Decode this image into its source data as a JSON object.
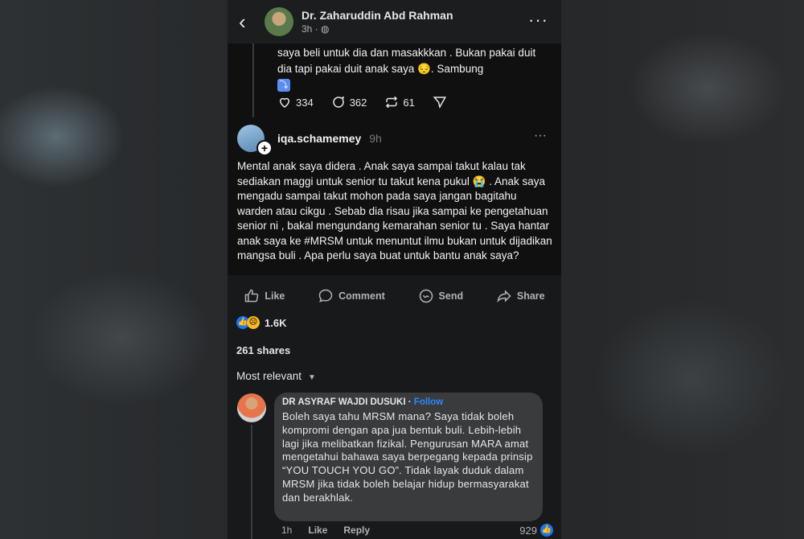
{
  "header": {
    "author": "Dr. Zaharuddin Abd Rahman",
    "meta": "3h · ◍"
  },
  "thread_post": {
    "text": "saya beli untuk dia dan masakkkan . Bukan pakai duit dia tapi pakai duit anak saya 😔. Sambung",
    "continue_icon": "⤵",
    "likes": "334",
    "comments": "362",
    "reposts": "61"
  },
  "reply_post": {
    "username": "iqa.schamemey",
    "time": "9h",
    "body": "Mental anak saya didera . Anak saya sampai takut kalau tak sediakan maggi untuk senior tu takut kena pukul 😭 . Anak saya mengadu sampai takut mohon pada saya jangan bagitahu warden atau cikgu . Sebab dia risau jika sampai ke pengetahuan senior ni , bakal mengundang kemarahan senior tu . Saya hantar anak saya ke #MRSM untuk menuntut ilmu bukan untuk dijadikan mangsa buli . Apa perlu saya buat untuk bantu anak saya?"
  },
  "fb_actions": {
    "like": "Like",
    "comment": "Comment",
    "send": "Send",
    "share": "Share"
  },
  "stats": {
    "reactions": "1.6K",
    "shares": "261 shares"
  },
  "sort": {
    "label": "Most relevant"
  },
  "comment": {
    "author": "DR ASYRAF WAJDI DUSUKI",
    "follow": "Follow",
    "text": "Boleh saya tahu MRSM mana? Saya tidak boleh kompromi dengan apa jua bentuk buli. Lebih-lebih lagi jika melibatkan fizikal. Pengurusan MARA amat mengetahui bahawa saya berpegang kepada prinsip “YOU TOUCH YOU GO”. Tidak layak duduk dalam MRSM jika tidak boleh belajar hidup bermasyarakat dan berakhlak.",
    "time": "1h",
    "like": "Like",
    "reply": "Reply",
    "count": "929"
  },
  "colors": {
    "background": "#18191a",
    "card": "#101010",
    "bubble": "#3a3b3c",
    "link": "#2d88ff",
    "like_blue": "#1877f2"
  }
}
